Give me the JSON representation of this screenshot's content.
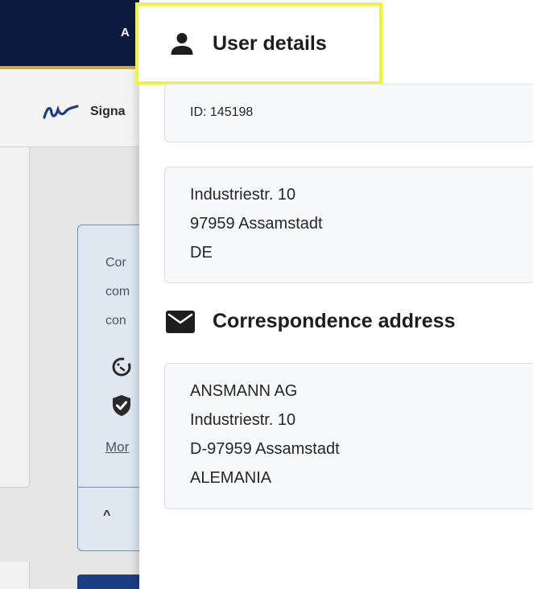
{
  "background": {
    "topbar_text": "A",
    "brand_label": "Signa",
    "info_lines": [
      "Cor",
      "com",
      "con"
    ],
    "more_link": "Mor",
    "caret": "^"
  },
  "drawer": {
    "user_details_title": "User details",
    "user_id": "ID: 145198",
    "user_address_lines": [
      "Industriestr. 10",
      "97959 Assamstadt",
      "DE"
    ],
    "correspondence_title": "Correspondence address",
    "correspondence_lines": [
      "ANSMANN AG",
      "Industriestr. 10",
      "D-97959 Assamstadt",
      "ALEMANIA"
    ]
  },
  "colors": {
    "topbar": "#0c1a3f",
    "highlight": "#eef53a",
    "card_bg": "#f7f8fa",
    "info_border": "#6f8fb3"
  },
  "icons": {
    "user_details": "person-icon",
    "correspondence": "envelope-icon"
  }
}
